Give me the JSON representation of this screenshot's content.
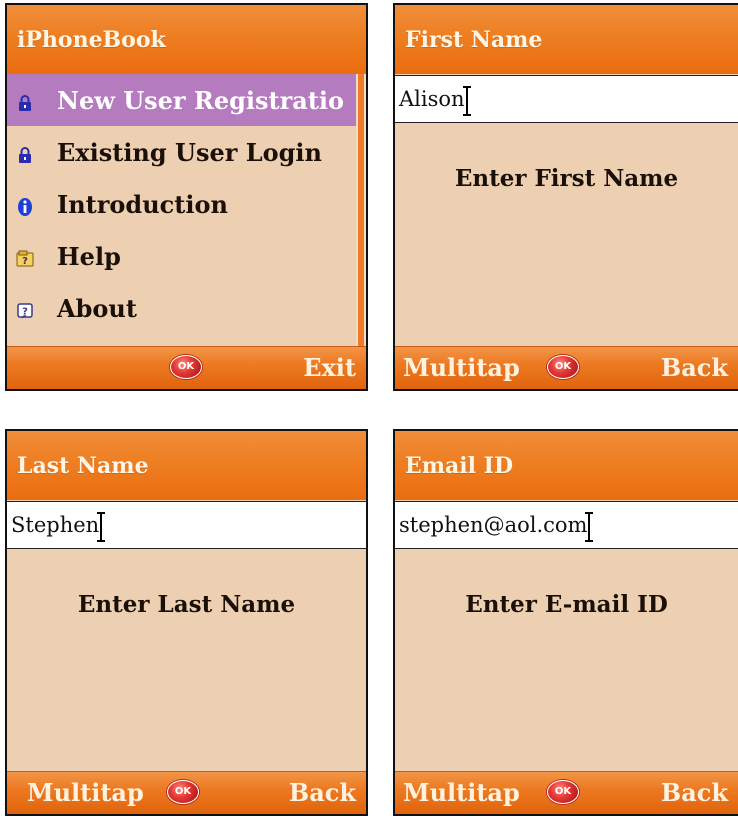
{
  "menu_screen": {
    "title": "iPhoneBook",
    "items": [
      {
        "label": "New User Registratio",
        "icon": "lock-icon",
        "selected": true
      },
      {
        "label": "Existing User Login",
        "icon": "lock-icon",
        "selected": false
      },
      {
        "label": "Introduction",
        "icon": "info-icon",
        "selected": false
      },
      {
        "label": "Help",
        "icon": "help-icon",
        "selected": false
      },
      {
        "label": "About",
        "icon": "question-icon",
        "selected": false
      }
    ],
    "softkeys": {
      "ok": "OK",
      "right": "Exit"
    }
  },
  "first_name_screen": {
    "title": "First Name",
    "input_value": "Alison",
    "prompt": "Enter First Name",
    "softkeys": {
      "left": "Multitap",
      "ok": "OK",
      "right": "Back"
    }
  },
  "last_name_screen": {
    "title": "Last Name",
    "input_value": "Stephen",
    "prompt": "Enter Last Name",
    "softkeys": {
      "left": "Multitap",
      "ok": "OK",
      "right": "Back"
    }
  },
  "email_screen": {
    "title": "Email ID",
    "input_value": "stephen@aol.com",
    "prompt": "Enter E-mail ID",
    "softkeys": {
      "left": "Multitap",
      "ok": "OK",
      "right": "Back"
    }
  },
  "colors": {
    "titlebar": "#ee7e22",
    "background": "#edcfb1",
    "selection": "#b47bbf",
    "ok_button": "#e53935"
  }
}
